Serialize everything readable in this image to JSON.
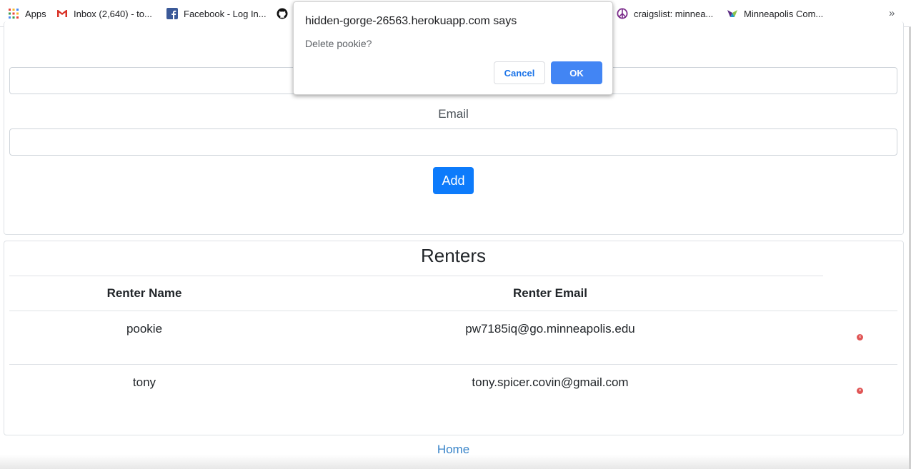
{
  "bookmarks": {
    "apps": "Apps",
    "gmail": "Inbox (2,640) - to...",
    "facebook": "Facebook - Log In...",
    "craigslist": "craigslist: minnea...",
    "minneapolis": "Minneapolis Com...",
    "more": "»"
  },
  "form": {
    "email_label": "Email",
    "add_label": "Add"
  },
  "renters": {
    "title": "Renters",
    "columns": [
      "Renter Name",
      "Renter Email"
    ],
    "rows": [
      {
        "name": "pookie",
        "email": "pw7185iq@go.minneapolis.edu"
      },
      {
        "name": "tony",
        "email": "tony.spicer.covin@gmail.com"
      }
    ]
  },
  "footer": {
    "home_link": "Home"
  },
  "dialog": {
    "title": "hidden-gorge-26563.herokuapp.com says",
    "message": "Delete pookie?",
    "cancel_label": "Cancel",
    "ok_label": "OK"
  },
  "colors": {
    "primary": "#0d7bfb",
    "dialog_ok": "#4285f4",
    "delete_icon": "#e05555",
    "link": "#3a85c9"
  }
}
